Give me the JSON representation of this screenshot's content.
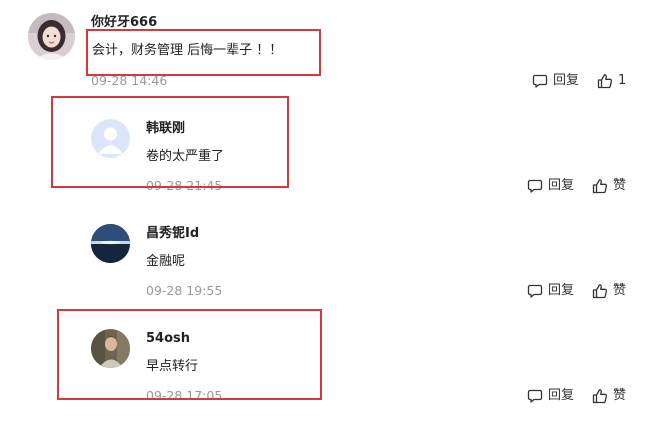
{
  "comments": [
    {
      "username": "你好牙666",
      "content": "会计，财务管理 后悔一辈子 ！！",
      "time": "09-28 14:46",
      "reply_label": "回复",
      "like_label": "1",
      "avatar_icon": "avatar-girl"
    },
    {
      "username": "韩联刚",
      "content": "卷的太严重了",
      "time": "09-28 21:45",
      "reply_label": "回复",
      "like_label": "赞",
      "avatar_icon": "avatar-default-person"
    },
    {
      "username": "昌秀铌Id",
      "content": "金融呢",
      "time": "09-28 19:55",
      "reply_label": "回复",
      "like_label": "赞",
      "avatar_icon": "avatar-sea-landscape"
    },
    {
      "username": "54osh",
      "content": "早点转行",
      "time": "09-28 17:05",
      "reply_label": "回复",
      "like_label": "赞",
      "avatar_icon": "avatar-photo"
    }
  ],
  "colors": {
    "highlight_border": "#d9363e",
    "username": "#222222",
    "timestamp": "#9a9a9a",
    "action_text": "#333333"
  }
}
